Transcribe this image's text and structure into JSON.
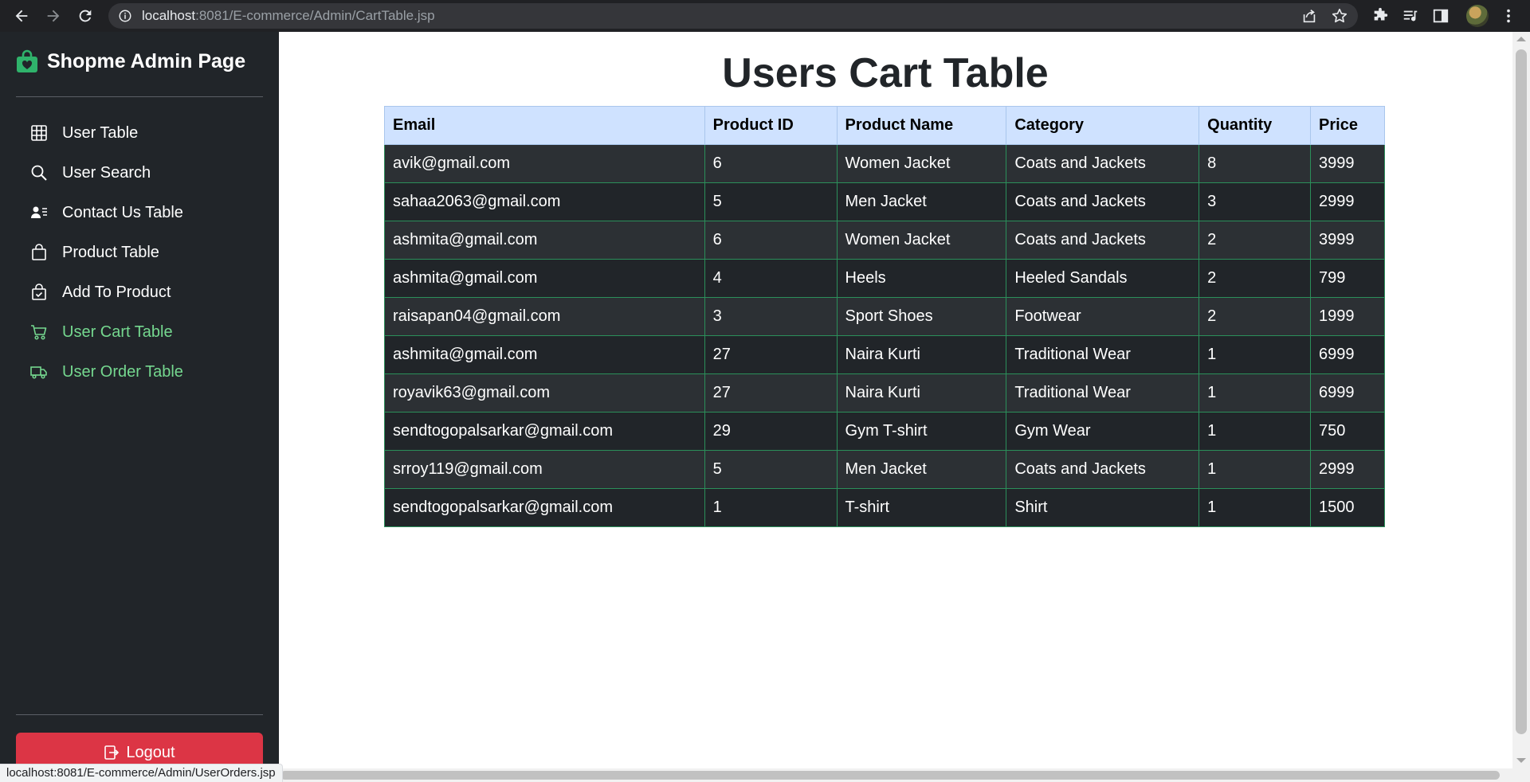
{
  "browser": {
    "url_host": "localhost",
    "url_rest": ":8081/E-commerce/Admin/CartTable.jsp",
    "status_url": "localhost:8081/E-commerce/Admin/UserOrders.jsp"
  },
  "sidebar": {
    "brand": "Shopme Admin Page",
    "items": [
      {
        "label": "User Table",
        "icon": "table-icon",
        "active": false
      },
      {
        "label": "User Search",
        "icon": "search-icon",
        "active": false
      },
      {
        "label": "Contact Us Table",
        "icon": "person-lines-icon",
        "active": false
      },
      {
        "label": "Product Table",
        "icon": "bag-icon",
        "active": false
      },
      {
        "label": "Add To Product",
        "icon": "bag-check-icon",
        "active": false
      },
      {
        "label": "User Cart Table",
        "icon": "cart-icon",
        "active": true
      },
      {
        "label": "User Order Table",
        "icon": "truck-icon",
        "active": true
      }
    ],
    "logout_label": "Logout"
  },
  "main": {
    "title": "Users Cart Table",
    "columns": [
      "Email",
      "Product ID",
      "Product Name",
      "Category",
      "Quantity",
      "Price"
    ],
    "rows": [
      [
        "avik@gmail.com",
        "6",
        "Women Jacket",
        "Coats and Jackets",
        "8",
        "3999"
      ],
      [
        "sahaa2063@gmail.com",
        "5",
        "Men Jacket",
        "Coats and Jackets",
        "3",
        "2999"
      ],
      [
        "ashmita@gmail.com",
        "6",
        "Women Jacket",
        "Coats and Jackets",
        "2",
        "3999"
      ],
      [
        "ashmita@gmail.com",
        "4",
        "Heels",
        "Heeled Sandals",
        "2",
        "799"
      ],
      [
        "raisapan04@gmail.com",
        "3",
        "Sport Shoes",
        "Footwear",
        "2",
        "1999"
      ],
      [
        "ashmita@gmail.com",
        "27",
        "Naira Kurti",
        "Traditional Wear",
        "1",
        "6999"
      ],
      [
        "royavik63@gmail.com",
        "27",
        "Naira Kurti",
        "Traditional Wear",
        "1",
        "6999"
      ],
      [
        "sendtogopalsarkar@gmail.com",
        "29",
        "Gym T-shirt",
        "Gym Wear",
        "1",
        "750"
      ],
      [
        "srroy119@gmail.com",
        "5",
        "Men Jacket",
        "Coats and Jackets",
        "1",
        "2999"
      ],
      [
        "sendtogopalsarkar@gmail.com",
        "1",
        "T-shirt",
        "Shirt",
        "1",
        "1500"
      ]
    ]
  },
  "colors": {
    "sidebar_bg": "#212529",
    "active_link": "#75d88f",
    "brand_icon": "#2fb36b",
    "logout_bg": "#dc3545",
    "table_header_bg": "#cfe2ff",
    "table_border": "#2b8f5a"
  }
}
